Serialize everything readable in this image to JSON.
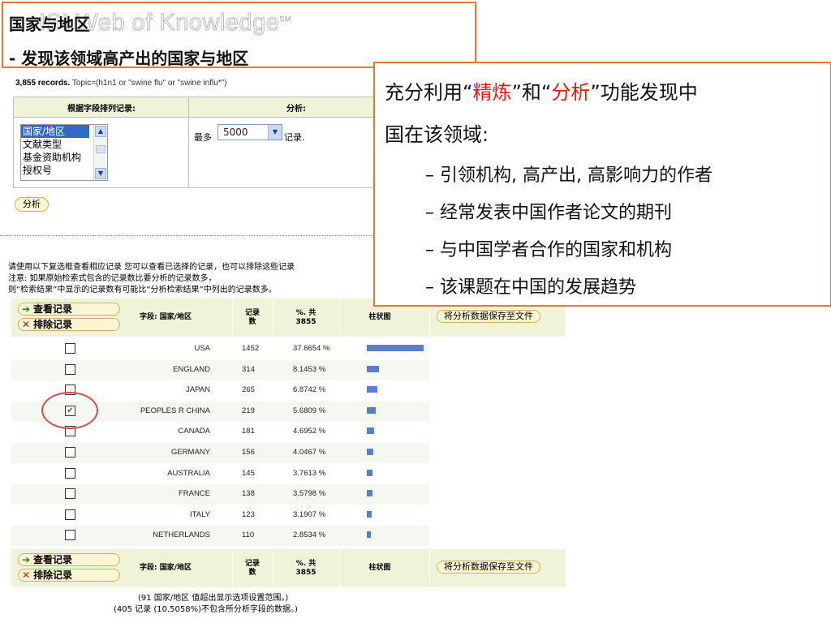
{
  "title": {
    "watermark": "ISI Web of Knowledge",
    "watermark_sup": "SM",
    "line1": "国家与地区",
    "line2": "- 发现该领域高产出的国家与地区"
  },
  "form": {
    "records_count": "3,855 records.",
    "records_query": " Topic=(h1n1 or \"swine flu\" or \"swine influ*\")",
    "head_rank": "根据字段排列记录:",
    "head_analysis": "分析:",
    "fields": [
      "国家/地区",
      "文献类型",
      "基金资助机构",
      "授权号"
    ],
    "most_label": "最多",
    "most_value": "5000",
    "record_unit": "记录.",
    "analyze_button": "分析"
  },
  "instructions": {
    "line1": "请使用以下复选框查看相应记录  您可以查看已选择的记录，也可以排除这些记录",
    "line2": "注意: 如果原始检索式包含的记录数比要分析的记录数多，",
    "line3": "则“检索结果”中显示的记录数有可能比“分析检索结果”中列出的记录数多。"
  },
  "results": {
    "view_button": "查看记录",
    "exclude_button": "排除记录",
    "col_field": "字段: 国家/地区",
    "col_count_l1": "记录",
    "col_count_l2": "数",
    "col_pct_l1": "%. 共",
    "col_pct_l2": "3855",
    "col_bar": "柱状图",
    "save_button": "将分析数据保存至文件",
    "rows": [
      {
        "country": "USA",
        "count": "1452",
        "pct": "37.6654 %",
        "checked": false
      },
      {
        "country": "ENGLAND",
        "count": "314",
        "pct": "8.1453 %",
        "checked": false
      },
      {
        "country": "JAPAN",
        "count": "265",
        "pct": "6.8742 %",
        "checked": false
      },
      {
        "country": "PEOPLES R CHINA",
        "count": "219",
        "pct": "5.6809 %",
        "checked": true
      },
      {
        "country": "CANADA",
        "count": "181",
        "pct": "4.6952 %",
        "checked": false
      },
      {
        "country": "GERMANY",
        "count": "156",
        "pct": "4.0467 %",
        "checked": false
      },
      {
        "country": "AUSTRALIA",
        "count": "145",
        "pct": "3.7613 %",
        "checked": false
      },
      {
        "country": "FRANCE",
        "count": "138",
        "pct": "3.5798 %",
        "checked": false
      },
      {
        "country": "ITALY",
        "count": "123",
        "pct": "3.1907 %",
        "checked": false
      },
      {
        "country": "NETHERLANDS",
        "count": "110",
        "pct": "2.8534 %",
        "checked": false
      }
    ],
    "bar_color": "#5b7fc6",
    "footnote1": "(91 国家/地区  值超出显示选项设置范围。)",
    "footnote2": "(405 记录  (10.5058%)不包含所分析字段的数据。)"
  },
  "callout": {
    "l1_pre": "充分利用“",
    "l1_red1": "精炼",
    "l1_mid": "”和“",
    "l1_red2": "分析",
    "l1_post": "”功能发现中",
    "l2": "国在该领域:",
    "bullets": [
      "– 引领机构, 高产出, 高影响力的作者",
      "– 经常发表中国作者论文的期刊",
      "– 与中国学者合作的国家和机构",
      "– 该课题在中国的发展趋势"
    ],
    "accent_color": "#e9782a",
    "highlight_color": "#e21a1a"
  }
}
